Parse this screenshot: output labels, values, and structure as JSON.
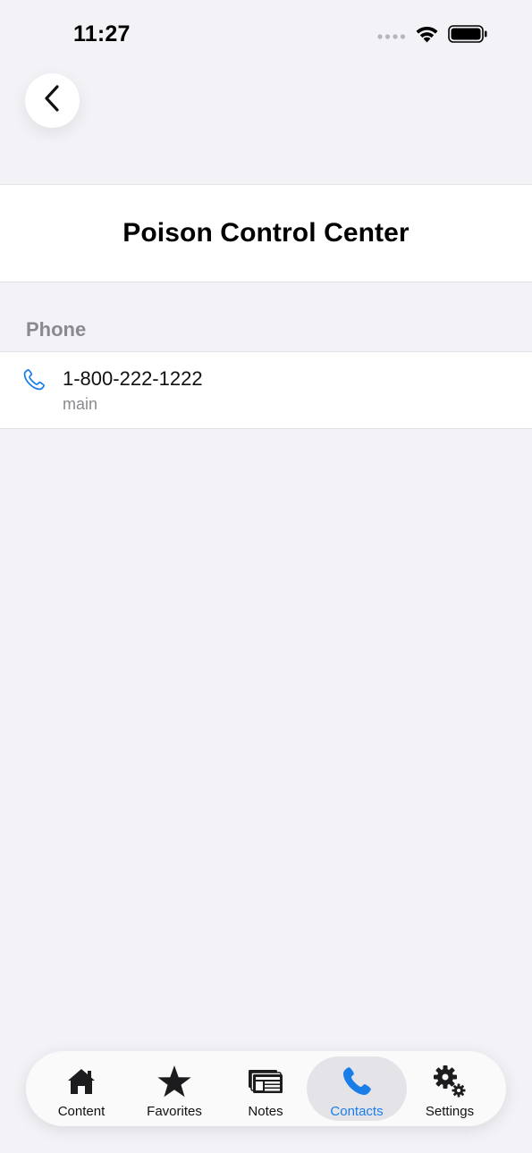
{
  "status_bar": {
    "time": "11:27"
  },
  "nav": {
    "back_icon": "chevron-left-icon"
  },
  "contact": {
    "title": "Poison Control Center"
  },
  "phone_section": {
    "header": "Phone",
    "items": [
      {
        "number": "1-800-222-1222",
        "label": "main",
        "icon": "phone-icon"
      }
    ]
  },
  "tab_bar": {
    "tabs": [
      {
        "label": "Content",
        "icon": "home-icon",
        "active": false
      },
      {
        "label": "Favorites",
        "icon": "star-icon",
        "active": false
      },
      {
        "label": "Notes",
        "icon": "notes-icon",
        "active": false
      },
      {
        "label": "Contacts",
        "icon": "phone-icon",
        "active": true
      },
      {
        "label": "Settings",
        "icon": "gears-icon",
        "active": false
      }
    ]
  },
  "colors": {
    "accent": "#1a7ee8",
    "background": "#f2f2f7",
    "secondary_text": "#8a8a8e"
  }
}
